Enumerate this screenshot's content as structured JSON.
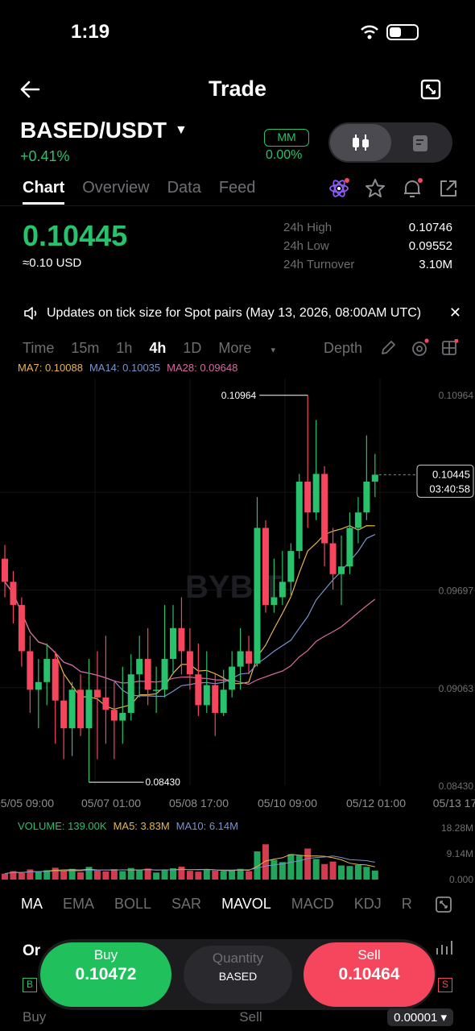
{
  "status": {
    "time": "1:19"
  },
  "header": {
    "title": "Trade"
  },
  "pair": {
    "name": "BASED/USDT",
    "change": "+0.41%",
    "mm_label": "MM",
    "mm_value": "0.00%"
  },
  "tabs": [
    "Chart",
    "Overview",
    "Data",
    "Feed"
  ],
  "price": {
    "last": "0.10445",
    "usd": "≈0.10 USD"
  },
  "stats": [
    {
      "label": "24h High",
      "value": "0.10746"
    },
    {
      "label": "24h Low",
      "value": "0.09552"
    },
    {
      "label": "24h Turnover",
      "value": "3.10M"
    }
  ],
  "notice": "Updates on tick size for Spot pairs (May 13, 2026, 08:00AM UTC)",
  "timeframes": [
    "Time",
    "15m",
    "1h",
    "4h",
    "1D",
    "More",
    "Depth"
  ],
  "active_timeframe": "4h",
  "ma_legend": {
    "ma7": "MA7: 0.10088",
    "ma14": "MA14: 0.10035",
    "ma28": "MA28: 0.09648"
  },
  "vol_legend": {
    "vol": "VOLUME: 139.00K",
    "ma5": "MA5: 3.83M",
    "ma10": "MA10: 6.14M"
  },
  "indicators": [
    "MA",
    "EMA",
    "BOLL",
    "SAR",
    "MAVOL",
    "MACD",
    "KDJ",
    "R"
  ],
  "colors": {
    "up": "#27c26b",
    "down": "#f6465d",
    "ma7": "#e8b64c",
    "ma14": "#7b93c9",
    "ma28": "#d96aa0"
  },
  "chart_data": {
    "type": "candlestick",
    "y_axis_labels": [
      "0.10964",
      "0.09697",
      "0.09063",
      "0.08430"
    ],
    "x_axis_labels": [
      "05/05 09:00",
      "05/07 01:00",
      "05/08 17:00",
      "05/10 09:00",
      "05/12 01:00",
      "05/13 17"
    ],
    "high_label": "0.10964",
    "low_label": "0.08430",
    "current_price": "0.10445",
    "countdown": "03:40:58",
    "watermark": "BYBIT",
    "ylim": [
      0.0843,
      0.10964
    ],
    "candles": [
      [
        0.099,
        0.0975,
        0.0999,
        0.0965
      ],
      [
        0.0975,
        0.096,
        0.0982,
        0.0948
      ],
      [
        0.096,
        0.093,
        0.0965,
        0.092
      ],
      [
        0.093,
        0.0905,
        0.094,
        0.089
      ],
      [
        0.0905,
        0.091,
        0.0925,
        0.088
      ],
      [
        0.091,
        0.0925,
        0.0935,
        0.0895
      ],
      [
        0.0925,
        0.0898,
        0.093,
        0.087
      ],
      [
        0.0898,
        0.088,
        0.0915,
        0.086
      ],
      [
        0.088,
        0.0905,
        0.091,
        0.0862
      ],
      [
        0.0905,
        0.088,
        0.0915,
        0.0875
      ],
      [
        0.088,
        0.0905,
        0.0925,
        0.0845
      ],
      [
        0.0905,
        0.09,
        0.093,
        0.086
      ],
      [
        0.09,
        0.0892,
        0.094,
        0.087
      ],
      [
        0.0892,
        0.0885,
        0.091,
        0.086
      ],
      [
        0.0885,
        0.089,
        0.092,
        0.087
      ],
      [
        0.089,
        0.0915,
        0.0928,
        0.0885
      ],
      [
        0.0915,
        0.0925,
        0.094,
        0.09
      ],
      [
        0.0925,
        0.0905,
        0.0945,
        0.0895
      ],
      [
        0.0905,
        0.0905,
        0.092,
        0.089
      ],
      [
        0.0905,
        0.0925,
        0.096,
        0.09
      ],
      [
        0.0925,
        0.0945,
        0.096,
        0.0915
      ],
      [
        0.0945,
        0.093,
        0.0965,
        0.0915
      ],
      [
        0.093,
        0.0915,
        0.0945,
        0.0905
      ],
      [
        0.0915,
        0.0895,
        0.0935,
        0.0888
      ],
      [
        0.0895,
        0.0908,
        0.093,
        0.089
      ],
      [
        0.0908,
        0.089,
        0.0915,
        0.0875
      ],
      [
        0.089,
        0.0905,
        0.0918,
        0.0888
      ],
      [
        0.0905,
        0.092,
        0.093,
        0.09
      ],
      [
        0.092,
        0.093,
        0.0945,
        0.0905
      ],
      [
        0.093,
        0.0922,
        0.094,
        0.0915
      ],
      [
        0.0922,
        0.101,
        0.103,
        0.092
      ],
      [
        0.101,
        0.096,
        0.1015,
        0.0955
      ],
      [
        0.096,
        0.0965,
        0.099,
        0.0955
      ],
      [
        0.0965,
        0.0975,
        0.0995,
        0.096
      ],
      [
        0.0975,
        0.0995,
        0.1,
        0.0965
      ],
      [
        0.0995,
        0.104,
        0.1045,
        0.099
      ],
      [
        0.104,
        0.102,
        0.1096,
        0.101
      ],
      [
        0.102,
        0.1045,
        0.108,
        0.1015
      ],
      [
        0.1045,
        0.1,
        0.105,
        0.0985
      ],
      [
        0.1,
        0.098,
        0.101,
        0.097
      ],
      [
        0.098,
        0.0985,
        0.1005,
        0.096
      ],
      [
        0.0985,
        0.101,
        0.102,
        0.098
      ],
      [
        0.101,
        0.102,
        0.103,
        0.1
      ],
      [
        0.102,
        0.104,
        0.107,
        0.1015
      ],
      [
        0.104,
        0.10445,
        0.1058,
        0.103
      ]
    ],
    "volume_y_labels": [
      "18.28M",
      "9.14M",
      "0.000"
    ],
    "volumes": [
      2.1,
      3.0,
      2.4,
      3.6,
      2.9,
      3.3,
      4.2,
      3.1,
      3.8,
      2.6,
      4.5,
      3.2,
      2.9,
      3.7,
      3.0,
      4.1,
      3.3,
      3.9,
      2.5,
      3.4,
      4.0,
      4.6,
      3.1,
      2.8,
      3.6,
      3.2,
      2.9,
      3.5,
      3.8,
      3.0,
      10.0,
      12.5,
      7.0,
      6.2,
      9.0,
      8.5,
      11.0,
      7.3,
      5.5,
      6.4,
      5.0,
      4.8,
      5.2,
      4.5,
      3.2
    ]
  },
  "trade": {
    "buy_label": "Buy",
    "buy_price": "0.10472",
    "qty_label": "Quantity",
    "qty_unit": "BASED",
    "sell_label": "Sell",
    "sell_price": "0.10464"
  },
  "footer": {
    "buy": "Buy",
    "sell": "Sell",
    "tick": "0.00001 ▾",
    "left_partial": "Or"
  }
}
